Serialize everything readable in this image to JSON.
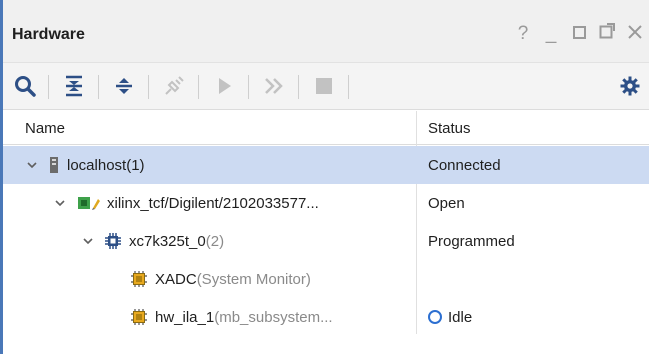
{
  "window": {
    "title": "Hardware",
    "controls": [
      "?",
      "_"
    ]
  },
  "toolbar": {
    "buttons": [
      {
        "icon": "search-icon"
      },
      {
        "icon": "collapse-all-icon"
      },
      {
        "icon": "expand-all-icon"
      },
      {
        "icon": "auto-connect-icon"
      },
      {
        "icon": "run-trigger-icon"
      },
      {
        "icon": "run-trigger-immediate-icon"
      },
      {
        "icon": "stop-trigger-icon"
      },
      {
        "icon": "settings-gear-icon"
      }
    ]
  },
  "table": {
    "columns": {
      "name": "Name",
      "status": "Status"
    },
    "rows": [
      {
        "name": "localhost",
        "suffix": " (1)",
        "status": "Connected",
        "selected": true
      },
      {
        "name": "xilinx_tcf/Digilent/2102033577...",
        "suffix": "",
        "status": "Open"
      },
      {
        "name": "xc7k325t_0",
        "suffix": " (2)",
        "status": "Programmed"
      },
      {
        "name": "XADC",
        "suffix": " (System Monitor)",
        "status": ""
      },
      {
        "name": "hw_ila_1",
        "suffix": " (mb_subsystem...",
        "status": "Idle"
      }
    ]
  },
  "colors": {
    "selection": "#ccdaf2",
    "accent": "#4a78b8",
    "idle": "#2c6fd1"
  }
}
